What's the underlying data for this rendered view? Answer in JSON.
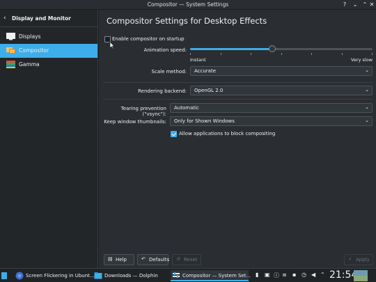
{
  "window": {
    "title": "Compositor — System Settings",
    "help_glyph": "?",
    "min_glyph": "⌄",
    "max_glyph": "⌃",
    "close_glyph": "✕"
  },
  "sidebar": {
    "header": "Display and Monitor",
    "back_glyph": "‹",
    "items": [
      {
        "label": "Displays",
        "icon": "monitor-icon"
      },
      {
        "label": "Compositor",
        "icon": "compositor-icon",
        "active": true
      },
      {
        "label": "Gamma",
        "icon": "gamma-icon"
      }
    ]
  },
  "main": {
    "title": "Compositor Settings for Desktop Effects",
    "enable_on_startup": {
      "label": "Enable compositor on startup",
      "checked": false
    },
    "animation_speed": {
      "label": "Animation speed:",
      "min_label": "Instant",
      "max_label": "Very slow",
      "value": 0.45
    },
    "scale_method": {
      "label": "Scale method:",
      "value": "Accurate"
    },
    "rendering_backend": {
      "label": "Rendering backend:",
      "value": "OpenGL 2.0"
    },
    "tearing_prevention": {
      "label": "Tearing prevention (\"vsync\"):",
      "value": "Automatic"
    },
    "keep_thumbnails": {
      "label": "Keep window thumbnails:",
      "value": "Only for Shown Windows"
    },
    "allow_block": {
      "label": "Allow applications to block compositing",
      "checked": true
    }
  },
  "buttons": {
    "help": "Help",
    "defaults": "Defaults",
    "reset": "Reset",
    "apply": "Apply"
  },
  "taskbar": {
    "tasks": [
      {
        "label": "Screen Flickering in Ubunt...",
        "icon": "browser-icon"
      },
      {
        "label": "Downloads — Dolphin",
        "icon": "folder-icon"
      },
      {
        "label": "Compositor — System Set...",
        "icon": "settings-icon",
        "active": true
      }
    ],
    "clock": "21:54"
  },
  "colors": {
    "accent": "#3daee9",
    "window_bg": "#2a2e32",
    "sidebar_bg": "#232629"
  }
}
